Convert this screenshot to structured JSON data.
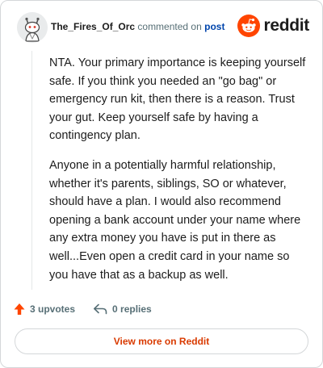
{
  "header": {
    "username": "The_Fires_Of_Orc",
    "action_text": "commented on",
    "post_link": "post",
    "brand": "reddit"
  },
  "comment": {
    "paragraphs": [
      "NTA. Your primary importance is keeping yourself safe. If you think you needed an \"go bag\" or emergency run kit, then there is a reason. Trust your gut. Keep yourself safe by having a contingency plan.",
      "Anyone in a potentially harmful relationship, whether it's parents, siblings, SO or whatever, should have a plan. I would also recommend opening a bank account under your name where any extra money you have is put in there as well...Even open a credit card in your name so you have that as a backup as well."
    ]
  },
  "actions": {
    "upvotes": "3 upvotes",
    "replies": "0 replies"
  },
  "footer": {
    "view_button": "View more on Reddit"
  },
  "colors": {
    "accent": "#d93a00",
    "upvote": "#ff4500",
    "link": "#0045ac",
    "muted": "#576f76"
  },
  "icons": {
    "avatar": "snoo-avatar",
    "logo": "reddit-snoo-icon",
    "upvote": "upvote-arrow-icon",
    "reply": "reply-arrow-icon"
  }
}
